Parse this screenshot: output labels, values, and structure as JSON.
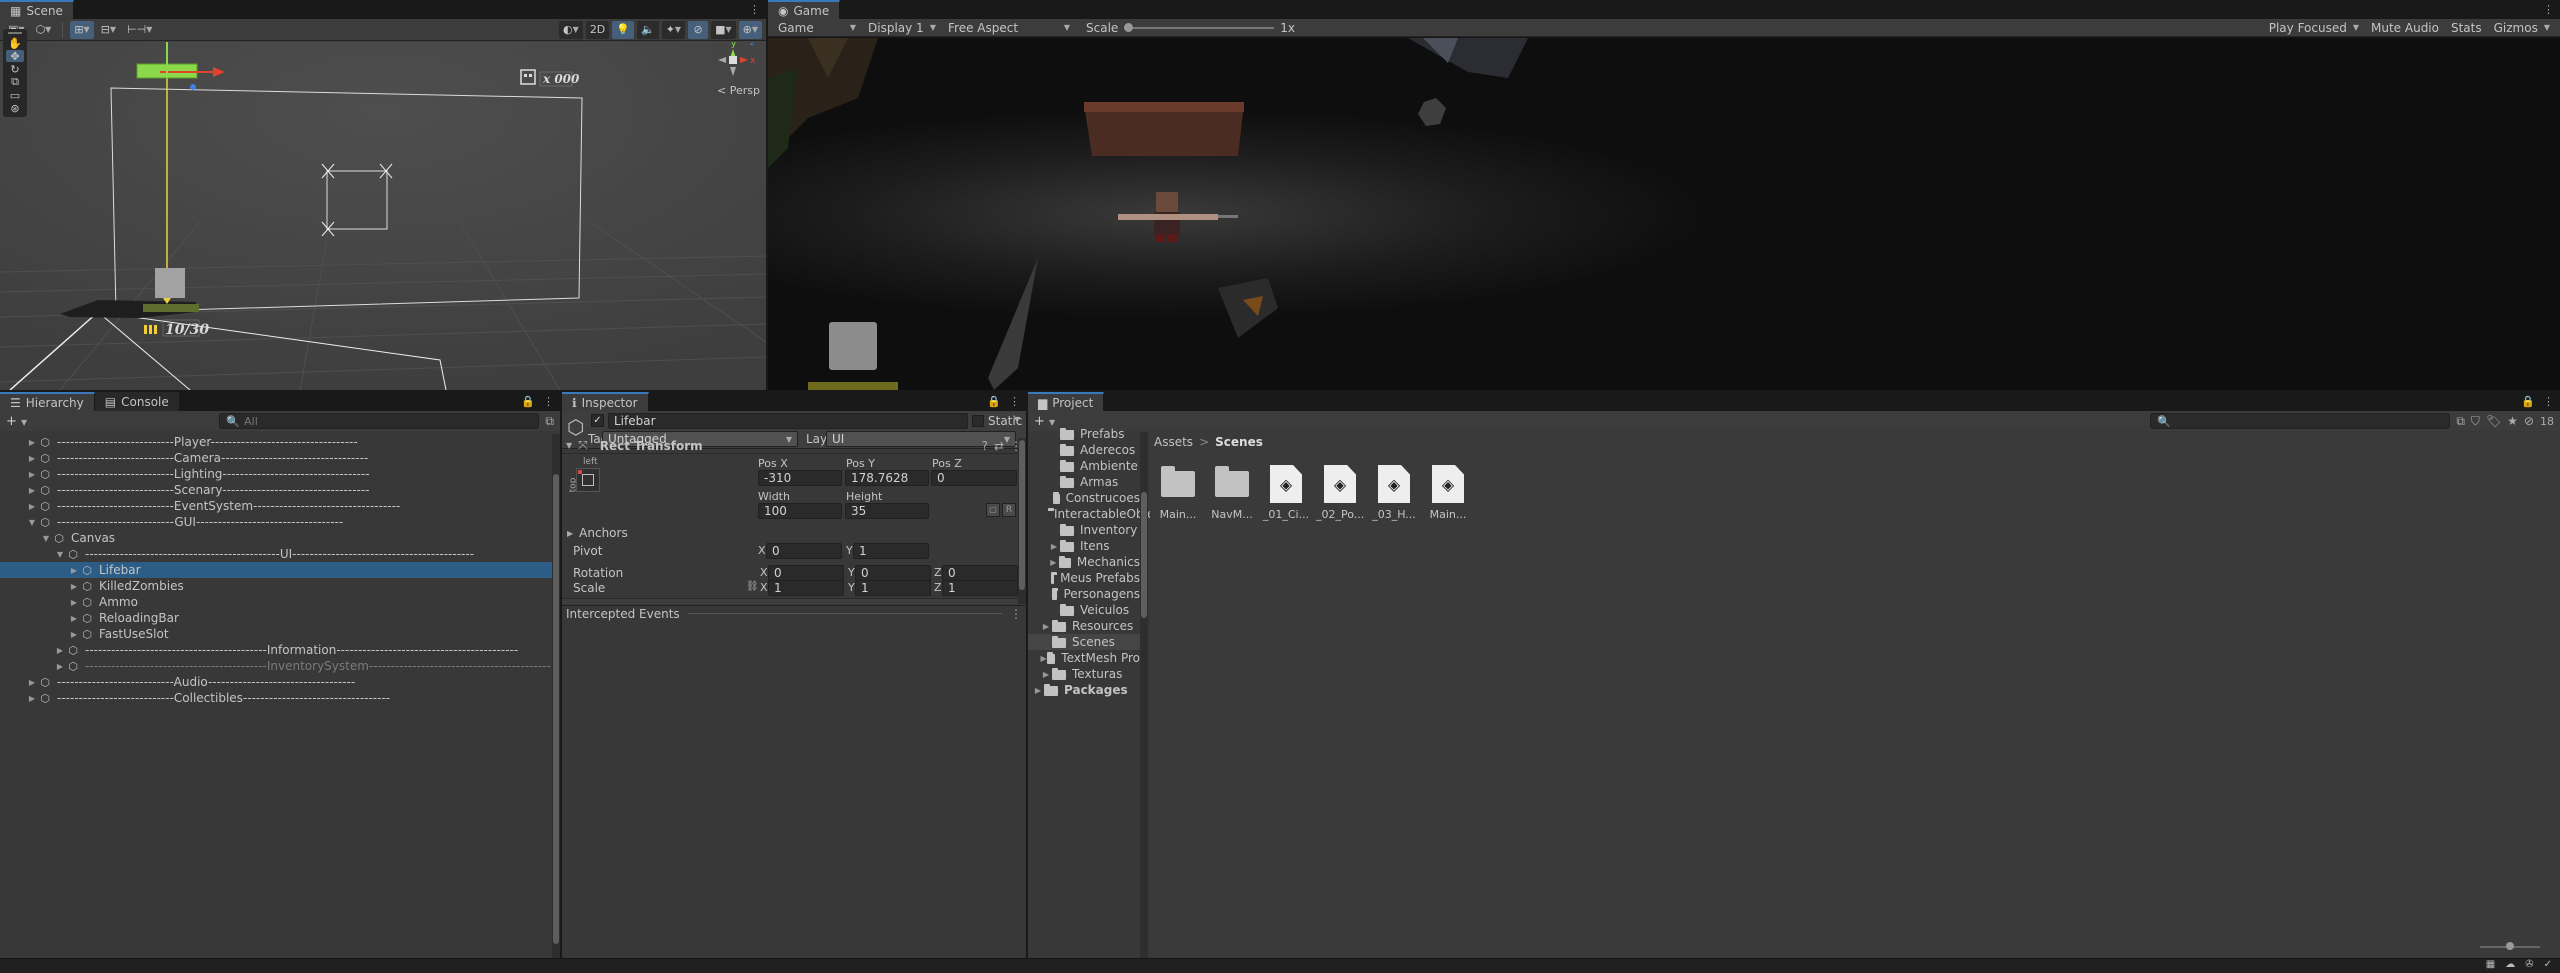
{
  "scene": {
    "tab": "Scene",
    "view_2d": "2D",
    "persp": "Persp",
    "gizmo_x": "x",
    "gizmo_y": "y",
    "gizmo_z": "z",
    "ammo_counter": "10/30",
    "score_counter": "x 000"
  },
  "game": {
    "tab": "Game",
    "mode": "Game",
    "display": "Display 1",
    "aspect": "Free Aspect",
    "scale_label": "Scale",
    "scale_value": "1x",
    "scale_fraction": 0.0,
    "play_focused": "Play Focused",
    "mute_audio": "Mute Audio",
    "stats": "Stats",
    "gizmos": "Gizmos"
  },
  "hierarchy": {
    "tabs": [
      "Hierarchy",
      "Console"
    ],
    "search_placeholder": "All",
    "rows": [
      {
        "label": "---------------------------Player----------------------------------",
        "indent": 0,
        "fold": "▶",
        "state": ""
      },
      {
        "label": "---------------------------Camera----------------------------------",
        "indent": 0,
        "fold": "▶",
        "state": ""
      },
      {
        "label": "---------------------------Lighting----------------------------------",
        "indent": 0,
        "fold": "▶",
        "state": ""
      },
      {
        "label": "---------------------------Scenary----------------------------------",
        "indent": 0,
        "fold": "▶",
        "state": ""
      },
      {
        "label": "---------------------------EventSystem----------------------------------",
        "indent": 0,
        "fold": "▶",
        "state": ""
      },
      {
        "label": "---------------------------GUI----------------------------------",
        "indent": 0,
        "fold": "▼",
        "state": ""
      },
      {
        "label": "Canvas",
        "indent": 1,
        "fold": "▼",
        "state": ""
      },
      {
        "label": "---------------------------------------------UI------------------------------------------",
        "indent": 2,
        "fold": "▼",
        "state": ""
      },
      {
        "label": "Lifebar",
        "indent": 3,
        "fold": "▶",
        "state": "sel"
      },
      {
        "label": "KilledZombies",
        "indent": 3,
        "fold": "▶",
        "state": ""
      },
      {
        "label": "Ammo",
        "indent": 3,
        "fold": "▶",
        "state": ""
      },
      {
        "label": "ReloadingBar",
        "indent": 3,
        "fold": "▶",
        "state": ""
      },
      {
        "label": "FastUseSlot",
        "indent": 3,
        "fold": "▶",
        "state": ""
      },
      {
        "label": "------------------------------------------Information------------------------------------------",
        "indent": 2,
        "fold": "▶",
        "state": ""
      },
      {
        "label": "------------------------------------------InventorySystem------------------------------------------",
        "indent": 2,
        "fold": "▶",
        "state": "dim"
      },
      {
        "label": "---------------------------Audio----------------------------------",
        "indent": 0,
        "fold": "▶",
        "state": ""
      },
      {
        "label": "---------------------------Collectibles----------------------------------",
        "indent": 0,
        "fold": "▶",
        "state": ""
      }
    ]
  },
  "inspector": {
    "tab": "Inspector",
    "object_name": "Lifebar",
    "static_label": "Static",
    "tag_label": "Tag",
    "tag_value": "Untagged",
    "layer_label": "Layer",
    "layer_value": "UI",
    "component": "Rect Transform",
    "anchor_h": "left",
    "anchor_v": "top",
    "pos_x_label": "Pos X",
    "pos_y_label": "Pos Y",
    "pos_z_label": "Pos Z",
    "pos_x": "-310",
    "pos_y": "178.7628",
    "pos_z": "0",
    "width_label": "Width",
    "height_label": "Height",
    "width": "100",
    "height": "35",
    "btn_r": "R",
    "anchors_label": "Anchors",
    "pivot_label": "Pivot",
    "pivot_x": "0",
    "pivot_y": "1",
    "rotation_label": "Rotation",
    "rot_x": "0",
    "rot_y": "0",
    "rot_z": "0",
    "scale_label": "Scale",
    "scale_x": "1",
    "scale_y": "1",
    "scale_z": "1",
    "axis_x": "X",
    "axis_y": "Y",
    "axis_z": "Z",
    "intercepted": "Intercepted Events"
  },
  "project": {
    "tab": "Project",
    "badge": "18",
    "tree": [
      {
        "label": "Prefabs",
        "indent": 2,
        "fold": "",
        "state": "cut"
      },
      {
        "label": "Aderecos",
        "indent": 2,
        "fold": "",
        "state": ""
      },
      {
        "label": "Ambiente",
        "indent": 2,
        "fold": "",
        "state": ""
      },
      {
        "label": "Armas",
        "indent": 2,
        "fold": "",
        "state": ""
      },
      {
        "label": "Construcoes",
        "indent": 2,
        "fold": "",
        "state": ""
      },
      {
        "label": "InteractableObject",
        "indent": 2,
        "fold": "",
        "state": ""
      },
      {
        "label": "Inventory",
        "indent": 2,
        "fold": "",
        "state": ""
      },
      {
        "label": "Itens",
        "indent": 2,
        "fold": "▶",
        "state": ""
      },
      {
        "label": "Mechanics",
        "indent": 2,
        "fold": "▶",
        "state": ""
      },
      {
        "label": "Meus Prefabs",
        "indent": 2,
        "fold": "",
        "state": ""
      },
      {
        "label": "Personagens",
        "indent": 2,
        "fold": "",
        "state": ""
      },
      {
        "label": "Veiculos",
        "indent": 2,
        "fold": "",
        "state": ""
      },
      {
        "label": "Resources",
        "indent": 1,
        "fold": "▶",
        "state": ""
      },
      {
        "label": "Scenes",
        "indent": 1,
        "fold": "",
        "state": "hov"
      },
      {
        "label": "TextMesh Pro",
        "indent": 1,
        "fold": "▶",
        "state": ""
      },
      {
        "label": "Texturas",
        "indent": 1,
        "fold": "▶",
        "state": ""
      },
      {
        "label": "Packages",
        "indent": 0,
        "fold": "▶",
        "state": "bold"
      }
    ],
    "breadcrumb_root": "Assets",
    "breadcrumb_sep": ">",
    "breadcrumb_current": "Scenes",
    "assets": [
      {
        "label": "Main...",
        "kind": "folder"
      },
      {
        "label": "NavM...",
        "kind": "folder"
      },
      {
        "label": "_01_Ci...",
        "kind": "scene"
      },
      {
        "label": "_02_Po...",
        "kind": "scene"
      },
      {
        "label": "_03_H...",
        "kind": "scene"
      },
      {
        "label": "Main...",
        "kind": "scene"
      }
    ]
  }
}
